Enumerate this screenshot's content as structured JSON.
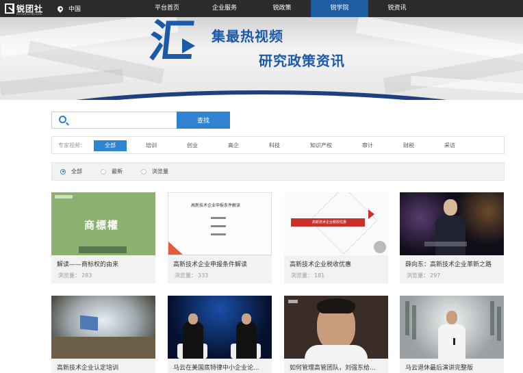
{
  "brand": {
    "name": "锐团社",
    "tagline": "RUISHUANGSHE"
  },
  "location": "中国",
  "nav": {
    "items": [
      {
        "label": "平台首页",
        "active": false
      },
      {
        "label": "企业服务",
        "active": false
      },
      {
        "label": "锐政策",
        "active": false
      },
      {
        "label": "锐学院",
        "active": true
      },
      {
        "label": "锐资讯",
        "active": false
      }
    ]
  },
  "banner": {
    "big_char": "汇",
    "line1": "集最热视频",
    "line2": "研究政策资讯"
  },
  "search": {
    "placeholder": "",
    "button_label": "查找"
  },
  "filter": {
    "label": "专家视频：",
    "categories": [
      "全部",
      "培训",
      "创业",
      "高企",
      "科技",
      "知识产权",
      "审计",
      "财税",
      "采访"
    ],
    "selected": "全部"
  },
  "sort": {
    "options": [
      "全部",
      "最新",
      "浏览量"
    ],
    "selected": "全部"
  },
  "views_label": "浏览量：",
  "thumbs": {
    "t1_big": "商標權",
    "t2_heading": "高新技术企业申报条件解读",
    "t3_banner": "高新技术企业税收优惠"
  },
  "videos": [
    {
      "title": "解读——商标权的由来",
      "views": "283"
    },
    {
      "title": "高新技术企业申报条件解读",
      "views": "333"
    },
    {
      "title": "高新技术企业税收优惠",
      "views": "181"
    },
    {
      "title": "薛向东：高新技术企业革新之路",
      "views": "297"
    },
    {
      "title": "高新技术企业认定培训",
      "views": ""
    },
    {
      "title": "马云在美国底特律中小企业论...",
      "views": ""
    },
    {
      "title": "如何管理高管团队，刘强东给...",
      "views": ""
    },
    {
      "title": "马云退休最后演讲完整版",
      "views": ""
    }
  ],
  "colors": {
    "nav_bg": "#2b2b2b",
    "accent": "#2f83d1",
    "nav_active": "#1e5da1",
    "banner_text": "#1b5aa8"
  }
}
